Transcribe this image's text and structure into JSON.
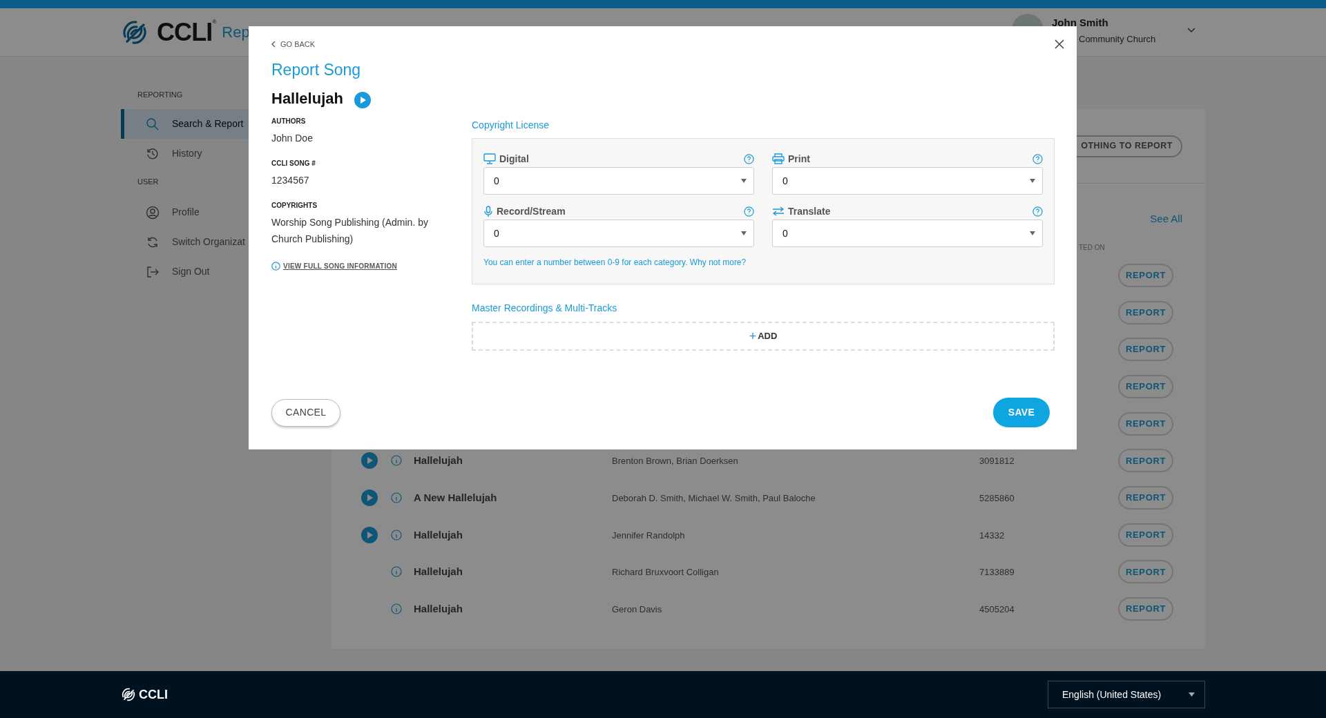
{
  "header": {
    "logo_text": "CCLI",
    "logo_mark": "®",
    "app_name": "Rep",
    "user": {
      "name": "John Smith",
      "organization": "Community Church"
    }
  },
  "sidebar": {
    "sections": [
      {
        "title": "REPORTING",
        "items": [
          {
            "label": "Search & Report",
            "selected": true
          },
          {
            "label": "History",
            "selected": false
          }
        ]
      },
      {
        "title": "USER",
        "items": [
          {
            "label": "Profile",
            "selected": false
          },
          {
            "label": "Switch Organizat",
            "selected": false
          },
          {
            "label": "Sign Out",
            "selected": false
          }
        ]
      }
    ]
  },
  "main": {
    "nothing_button": "OTHING TO REPORT",
    "see_all": "See All",
    "column_label": "TED ON",
    "rows": [
      {
        "action": "REPORT"
      },
      {
        "action": "REPORT"
      },
      {
        "action": "REPORT"
      },
      {
        "action": "REPORT"
      },
      {
        "action": "REPORT"
      },
      {
        "title": "Hallelujah",
        "authors": "Brenton Brown, Brian Doerksen",
        "song_number": "3091812",
        "playable": true,
        "action": "REPORT"
      },
      {
        "title": "A New Hallelujah",
        "authors": "Deborah D. Smith, Michael W. Smith, Paul Baloche",
        "song_number": "5285860",
        "playable": true,
        "action": "REPORT"
      },
      {
        "title": "Hallelujah",
        "authors": "Jennifer Randolph",
        "song_number": "14332",
        "playable": true,
        "action": "REPORT"
      },
      {
        "title": "Hallelujah",
        "authors": "Richard Bruxvoort Colligan",
        "song_number": "7133889",
        "playable": false,
        "action": "REPORT"
      },
      {
        "title": "Hallelujah",
        "authors": "Geron Davis",
        "song_number": "4505204",
        "playable": false,
        "action": "REPORT"
      }
    ]
  },
  "modal": {
    "back": "GO BACK",
    "title": "Report Song",
    "song": {
      "title": "Hallelujah",
      "details": [
        {
          "label": "AUTHORS",
          "value": "John Doe"
        },
        {
          "label": "CCLI SONG #",
          "value": "1234567"
        },
        {
          "label": "COPYRIGHTS",
          "value": "Worship Song Publishing (Admin. by Church Publishing)"
        }
      ],
      "info_link": "VIEW FULL SONG INFORMATION"
    },
    "license": {
      "title": "Copyright License",
      "fields": [
        {
          "label": "Digital",
          "value": "0"
        },
        {
          "label": "Print",
          "value": "0"
        },
        {
          "label": "Record/Stream",
          "value": "0"
        },
        {
          "label": "Translate",
          "value": "0"
        }
      ],
      "hint": "You can enter a number between 0-9 for each category. Why not more?"
    },
    "recordings": {
      "title": "Master Recordings & Multi-Tracks",
      "add_sign": "+",
      "add_label": "ADD"
    },
    "cancel": "CANCEL",
    "save": "SAVE"
  },
  "footer": {
    "logo_text": "CCLI",
    "language": "English (United States)"
  }
}
